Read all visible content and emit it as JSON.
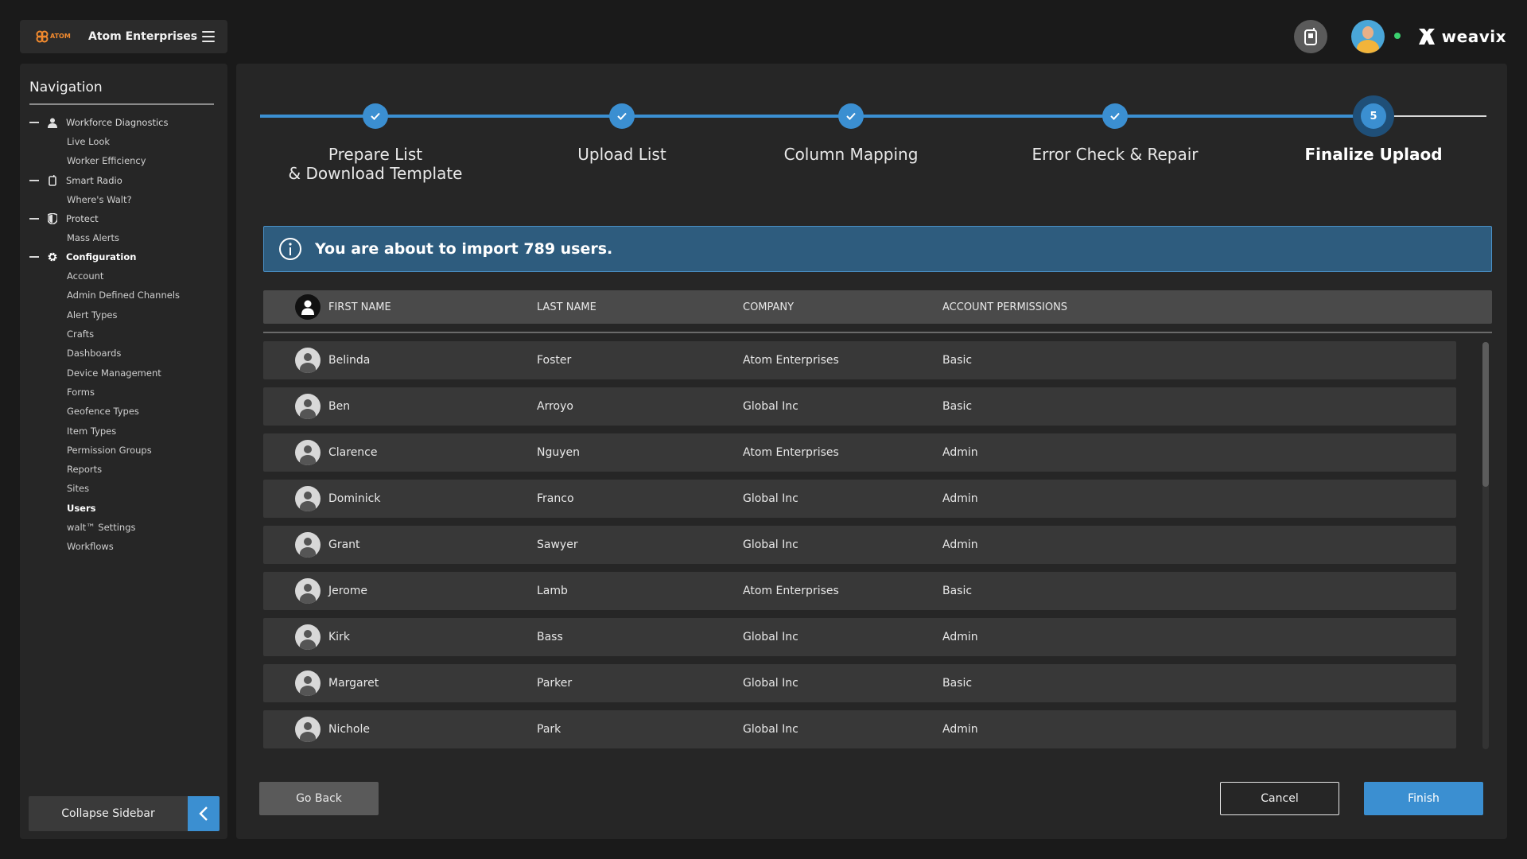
{
  "org": {
    "logo_text": "ATOM",
    "name": "Atom Enterprises"
  },
  "brand": {
    "name": "weavix"
  },
  "sidebar": {
    "title": "Navigation",
    "groups": [
      {
        "label": "Workforce Diagnostics",
        "icon": "person-icon",
        "items": [
          "Live Look",
          "Worker Efficiency"
        ]
      },
      {
        "label": "Smart Radio",
        "icon": "radio-icon",
        "items": [
          "Where's Walt?"
        ]
      },
      {
        "label": "Protect",
        "icon": "shield-icon",
        "items": [
          "Mass Alerts"
        ]
      },
      {
        "label": "Configuration",
        "icon": "gear-icon",
        "items": [
          "Account",
          "Admin Defined Channels",
          "Alert Types",
          "Crafts",
          "Dashboards",
          "Device Management",
          "Forms",
          "Geofence Types",
          "Item Types",
          "Permission Groups",
          "Reports",
          "Sites",
          "Users",
          "walt™ Settings",
          "Workflows"
        ]
      }
    ],
    "active_item": "Users",
    "collapse_label": "Collapse Sidebar"
  },
  "stepper": {
    "steps": [
      {
        "label": "Prepare List\n& Download Template",
        "status": "done"
      },
      {
        "label": "Upload List",
        "status": "done"
      },
      {
        "label": "Column Mapping",
        "status": "done"
      },
      {
        "label": "Error Check & Repair",
        "status": "done"
      },
      {
        "label": "Finalize Uplaod",
        "status": "current",
        "number": "5"
      }
    ]
  },
  "banner": {
    "text": "You are about to import 789 users."
  },
  "table": {
    "columns": [
      "FIRST NAME",
      "LAST NAME",
      "COMPANY",
      "ACCOUNT PERMISSIONS"
    ],
    "rows": [
      [
        "Belinda",
        "Foster",
        "Atom Enterprises",
        "Basic"
      ],
      [
        "Ben",
        "Arroyo",
        "Global Inc",
        "Basic"
      ],
      [
        "Clarence",
        "Nguyen",
        "Atom Enterprises",
        "Admin"
      ],
      [
        "Dominick",
        "Franco",
        "Global Inc",
        "Admin"
      ],
      [
        "Grant",
        "Sawyer",
        "Global Inc",
        "Admin"
      ],
      [
        "Jerome",
        "Lamb",
        "Atom Enterprises",
        "Basic"
      ],
      [
        "Kirk",
        "Bass",
        "Global Inc",
        "Admin"
      ],
      [
        "Margaret",
        "Parker",
        "Global Inc",
        "Basic"
      ],
      [
        "Nichole",
        "Park",
        "Global Inc",
        "Admin"
      ]
    ]
  },
  "buttons": {
    "back": "Go Back",
    "cancel": "Cancel",
    "finish": "Finish"
  },
  "colors": {
    "accent": "#3b8fd1",
    "banner": "#2e5c7e",
    "logo": "#f28a2e",
    "online": "#3bd16f"
  }
}
